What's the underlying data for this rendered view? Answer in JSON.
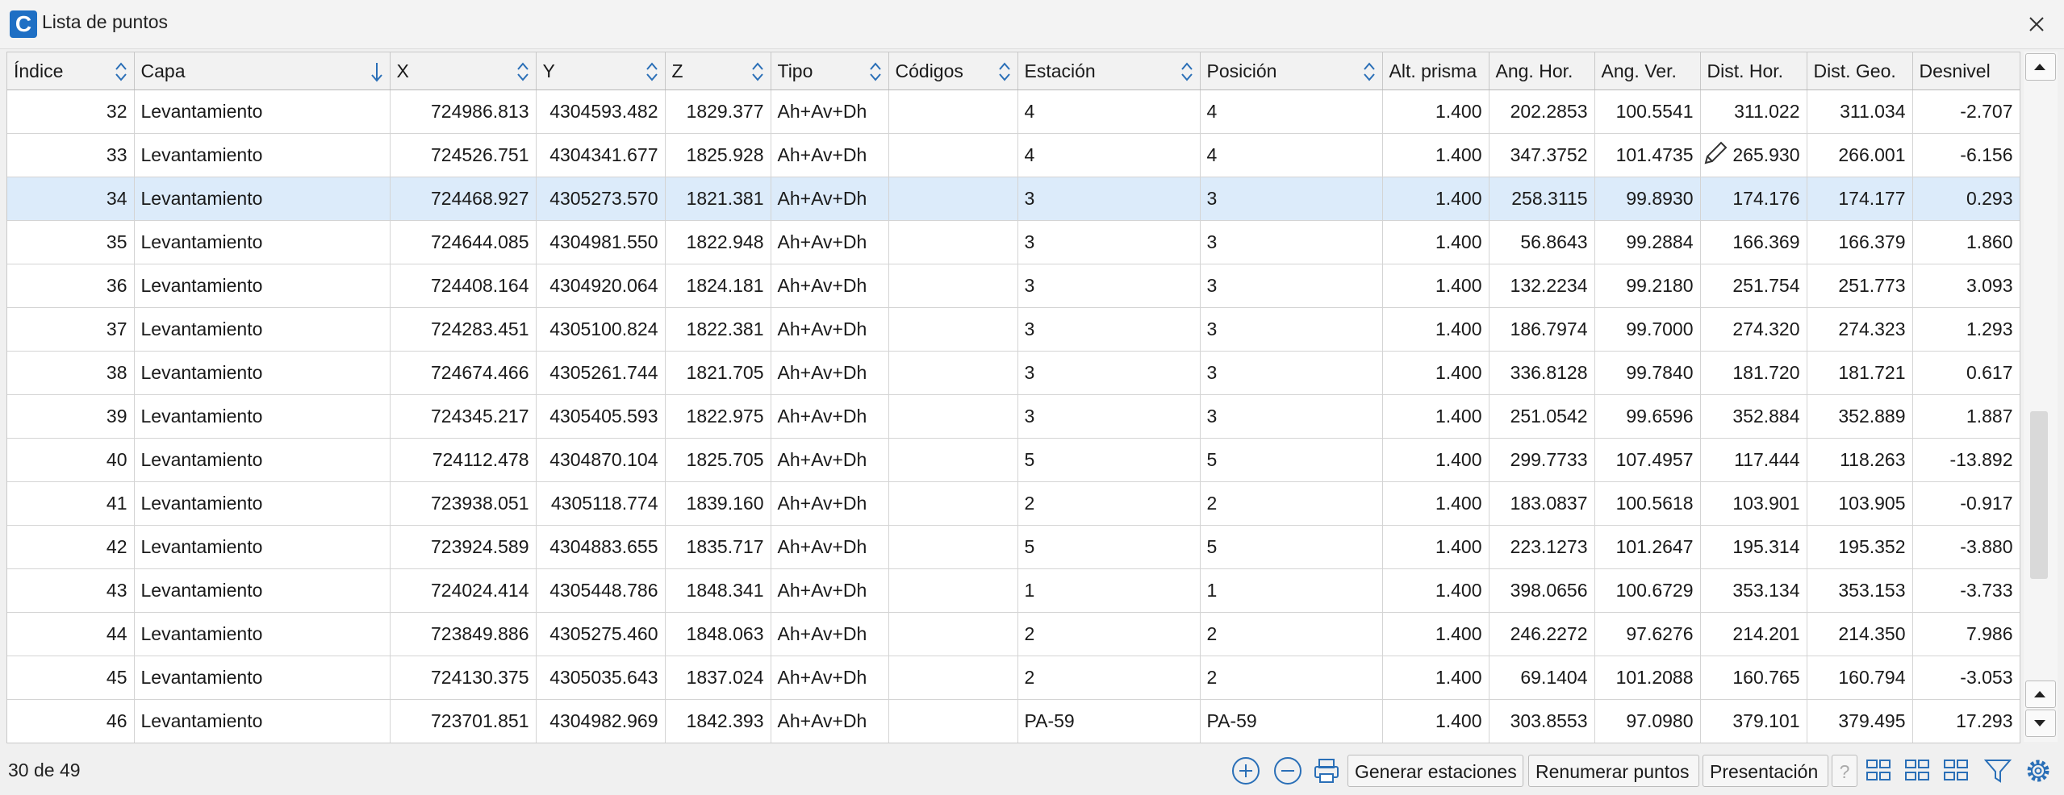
{
  "window": {
    "title": "Lista de puntos",
    "app_letter": "C"
  },
  "table": {
    "columns": [
      "Índice",
      "Capa",
      "X",
      "Y",
      "Z",
      "Tipo",
      "Códigos",
      "Estación",
      "Posición",
      "Alt. prisma",
      "Ang. Hor.",
      "Ang. Ver.",
      "Dist. Hor.",
      "Dist. Geo.",
      "Desnivel"
    ],
    "sorted_by": "Capa",
    "selected_index": "34",
    "rows": [
      [
        "32",
        "Levantamiento",
        "724986.813",
        "4304593.482",
        "1829.377",
        "Ah+Av+Dh",
        "",
        "4",
        "4",
        "1.400",
        "202.2853",
        "100.5541",
        "311.022",
        "311.034",
        "-2.707"
      ],
      [
        "33",
        "Levantamiento",
        "724526.751",
        "4304341.677",
        "1825.928",
        "Ah+Av+Dh",
        "",
        "4",
        "4",
        "1.400",
        "347.3752",
        "101.4735",
        "265.930",
        "266.001",
        "-6.156"
      ],
      [
        "34",
        "Levantamiento",
        "724468.927",
        "4305273.570",
        "1821.381",
        "Ah+Av+Dh",
        "",
        "3",
        "3",
        "1.400",
        "258.3115",
        "99.8930",
        "174.176",
        "174.177",
        "0.293"
      ],
      [
        "35",
        "Levantamiento",
        "724644.085",
        "4304981.550",
        "1822.948",
        "Ah+Av+Dh",
        "",
        "3",
        "3",
        "1.400",
        "56.8643",
        "99.2884",
        "166.369",
        "166.379",
        "1.860"
      ],
      [
        "36",
        "Levantamiento",
        "724408.164",
        "4304920.064",
        "1824.181",
        "Ah+Av+Dh",
        "",
        "3",
        "3",
        "1.400",
        "132.2234",
        "99.2180",
        "251.754",
        "251.773",
        "3.093"
      ],
      [
        "37",
        "Levantamiento",
        "724283.451",
        "4305100.824",
        "1822.381",
        "Ah+Av+Dh",
        "",
        "3",
        "3",
        "1.400",
        "186.7974",
        "99.7000",
        "274.320",
        "274.323",
        "1.293"
      ],
      [
        "38",
        "Levantamiento",
        "724674.466",
        "4305261.744",
        "1821.705",
        "Ah+Av+Dh",
        "",
        "3",
        "3",
        "1.400",
        "336.8128",
        "99.7840",
        "181.720",
        "181.721",
        "0.617"
      ],
      [
        "39",
        "Levantamiento",
        "724345.217",
        "4305405.593",
        "1822.975",
        "Ah+Av+Dh",
        "",
        "3",
        "3",
        "1.400",
        "251.0542",
        "99.6596",
        "352.884",
        "352.889",
        "1.887"
      ],
      [
        "40",
        "Levantamiento",
        "724112.478",
        "4304870.104",
        "1825.705",
        "Ah+Av+Dh",
        "",
        "5",
        "5",
        "1.400",
        "299.7733",
        "107.4957",
        "117.444",
        "118.263",
        "-13.892"
      ],
      [
        "41",
        "Levantamiento",
        "723938.051",
        "4305118.774",
        "1839.160",
        "Ah+Av+Dh",
        "",
        "2",
        "2",
        "1.400",
        "183.0837",
        "100.5618",
        "103.901",
        "103.905",
        "-0.917"
      ],
      [
        "42",
        "Levantamiento",
        "723924.589",
        "4304883.655",
        "1835.717",
        "Ah+Av+Dh",
        "",
        "5",
        "5",
        "1.400",
        "223.1273",
        "101.2647",
        "195.314",
        "195.352",
        "-3.880"
      ],
      [
        "43",
        "Levantamiento",
        "724024.414",
        "4305448.786",
        "1848.341",
        "Ah+Av+Dh",
        "",
        "1",
        "1",
        "1.400",
        "398.0656",
        "100.6729",
        "353.134",
        "353.153",
        "-3.733"
      ],
      [
        "44",
        "Levantamiento",
        "723849.886",
        "4305275.460",
        "1848.063",
        "Ah+Av+Dh",
        "",
        "2",
        "2",
        "1.400",
        "246.2272",
        "97.6276",
        "214.201",
        "214.350",
        "7.986"
      ],
      [
        "45",
        "Levantamiento",
        "724130.375",
        "4305035.643",
        "1837.024",
        "Ah+Av+Dh",
        "",
        "2",
        "2",
        "1.400",
        "69.1404",
        "101.2088",
        "160.765",
        "160.794",
        "-3.053"
      ],
      [
        "46",
        "Levantamiento",
        "723701.851",
        "4304982.969",
        "1842.393",
        "Ah+Av+Dh",
        "",
        "PA-59",
        "PA-59",
        "1.400",
        "303.8553",
        "97.0980",
        "379.101",
        "379.495",
        "17.293"
      ]
    ]
  },
  "status": {
    "count": "30 de 49"
  },
  "toolbar": {
    "generate_label": "Generar estaciones",
    "renumber_label": "Renumerar puntos",
    "presentation_label": "Presentación",
    "help_label": "?",
    "icons": [
      "add-icon",
      "remove-icon",
      "print-icon",
      "grid-view-icon",
      "grid-view-icon",
      "grid-view-icon",
      "filter-icon",
      "gear-icon"
    ]
  },
  "colors": {
    "selected_row": "#dcebfa",
    "accent": "#1e6fc4"
  }
}
